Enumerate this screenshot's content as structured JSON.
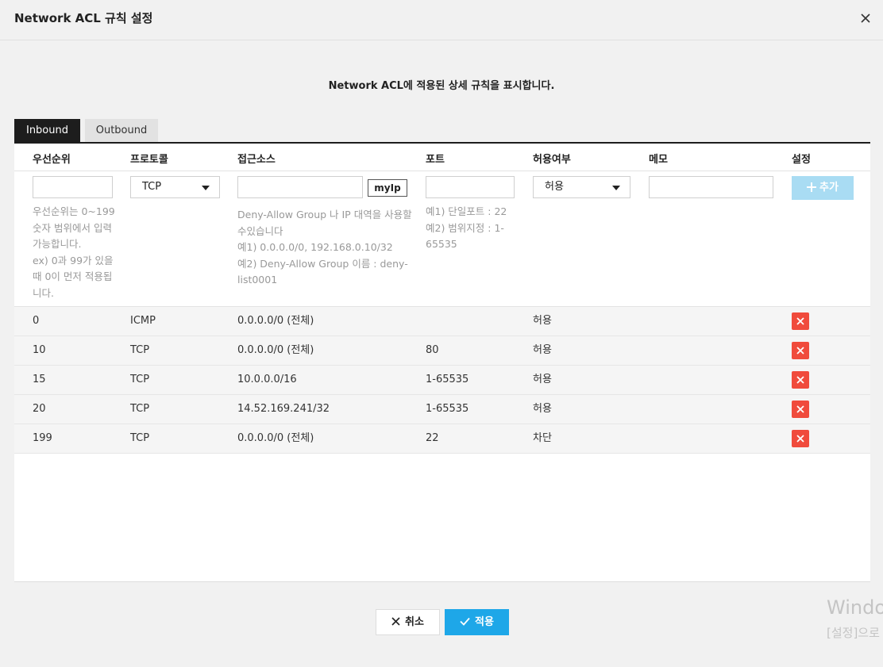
{
  "dialog": {
    "title": "Network ACL 규칙 설정",
    "description": "Network ACL에 적용된 상세 규칙을 표시합니다."
  },
  "tabs": [
    {
      "label": "Inbound",
      "active": true
    },
    {
      "label": "Outbound",
      "active": false
    }
  ],
  "columns": [
    "우선순위",
    "프로토콜",
    "접근소스",
    "포트",
    "허용여부",
    "메모",
    "설정"
  ],
  "form": {
    "priority_value": "",
    "protocol_selected": "TCP",
    "source_value": "",
    "myip_label": "myIp",
    "port_value": "",
    "allow_selected": "허용",
    "memo_value": "",
    "add_label": "추가",
    "help": {
      "priority": [
        "우선순위는 0~199",
        "숫자 범위에서 입력",
        "가능합니다.",
        "ex) 0과 99가 있을",
        "때 0이 먼저 적용됩",
        "니다."
      ],
      "source": [
        "Deny-Allow Group 나 IP 대역을 사용할",
        "수있습니다",
        "예1) 0.0.0.0/0, 192.168.0.10/32",
        "예2) Deny-Allow Group 이름 : deny-",
        "list0001"
      ],
      "port": [
        "예1) 단일포트 : 22",
        "예2) 범위지정 : 1-",
        "65535"
      ]
    }
  },
  "rules": [
    {
      "priority": "0",
      "protocol": "ICMP",
      "source": "0.0.0.0/0 (전체)",
      "port": "",
      "allow": "허용",
      "memo": ""
    },
    {
      "priority": "10",
      "protocol": "TCP",
      "source": "0.0.0.0/0 (전체)",
      "port": "80",
      "allow": "허용",
      "memo": ""
    },
    {
      "priority": "15",
      "protocol": "TCP",
      "source": "10.0.0.0/16",
      "port": "1-65535",
      "allow": "허용",
      "memo": ""
    },
    {
      "priority": "20",
      "protocol": "TCP",
      "source": "14.52.169.241/32",
      "port": "1-65535",
      "allow": "허용",
      "memo": ""
    },
    {
      "priority": "199",
      "protocol": "TCP",
      "source": "0.0.0.0/0 (전체)",
      "port": "22",
      "allow": "차단",
      "memo": ""
    }
  ],
  "footer": {
    "cancel_label": "취소",
    "apply_label": "적용"
  },
  "watermark": {
    "line1": "Windo",
    "line2": "[설정]으로"
  },
  "colors": {
    "accent": "#1ea7e8",
    "delete": "#f04b3c",
    "add_disabled": "#a9dcf3",
    "tab_active": "#1d1d1d"
  }
}
